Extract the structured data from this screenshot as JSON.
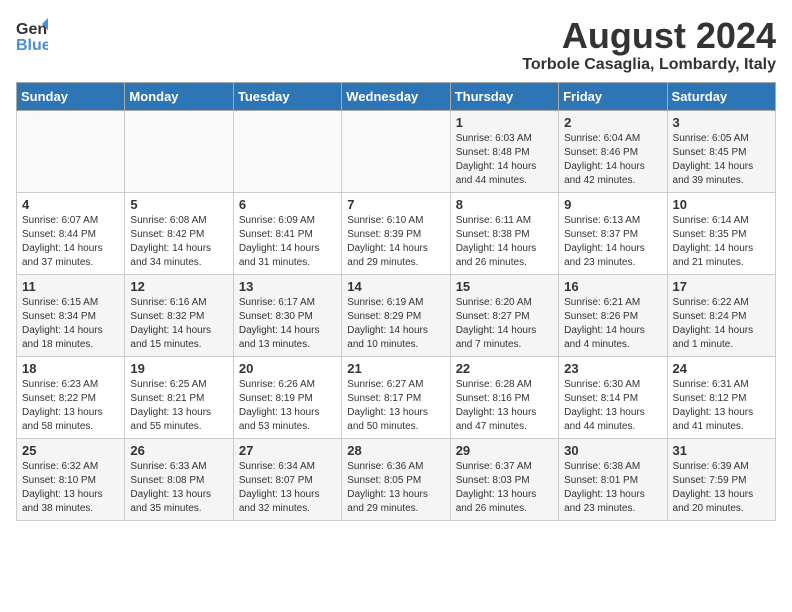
{
  "header": {
    "logo_general": "General",
    "logo_blue": "Blue",
    "main_title": "August 2024",
    "subtitle": "Torbole Casaglia, Lombardy, Italy"
  },
  "days_of_week": [
    "Sunday",
    "Monday",
    "Tuesday",
    "Wednesday",
    "Thursday",
    "Friday",
    "Saturday"
  ],
  "weeks": [
    [
      {
        "day": "",
        "info": ""
      },
      {
        "day": "",
        "info": ""
      },
      {
        "day": "",
        "info": ""
      },
      {
        "day": "",
        "info": ""
      },
      {
        "day": "1",
        "info": "Sunrise: 6:03 AM\nSunset: 8:48 PM\nDaylight: 14 hours\nand 44 minutes."
      },
      {
        "day": "2",
        "info": "Sunrise: 6:04 AM\nSunset: 8:46 PM\nDaylight: 14 hours\nand 42 minutes."
      },
      {
        "day": "3",
        "info": "Sunrise: 6:05 AM\nSunset: 8:45 PM\nDaylight: 14 hours\nand 39 minutes."
      }
    ],
    [
      {
        "day": "4",
        "info": "Sunrise: 6:07 AM\nSunset: 8:44 PM\nDaylight: 14 hours\nand 37 minutes."
      },
      {
        "day": "5",
        "info": "Sunrise: 6:08 AM\nSunset: 8:42 PM\nDaylight: 14 hours\nand 34 minutes."
      },
      {
        "day": "6",
        "info": "Sunrise: 6:09 AM\nSunset: 8:41 PM\nDaylight: 14 hours\nand 31 minutes."
      },
      {
        "day": "7",
        "info": "Sunrise: 6:10 AM\nSunset: 8:39 PM\nDaylight: 14 hours\nand 29 minutes."
      },
      {
        "day": "8",
        "info": "Sunrise: 6:11 AM\nSunset: 8:38 PM\nDaylight: 14 hours\nand 26 minutes."
      },
      {
        "day": "9",
        "info": "Sunrise: 6:13 AM\nSunset: 8:37 PM\nDaylight: 14 hours\nand 23 minutes."
      },
      {
        "day": "10",
        "info": "Sunrise: 6:14 AM\nSunset: 8:35 PM\nDaylight: 14 hours\nand 21 minutes."
      }
    ],
    [
      {
        "day": "11",
        "info": "Sunrise: 6:15 AM\nSunset: 8:34 PM\nDaylight: 14 hours\nand 18 minutes."
      },
      {
        "day": "12",
        "info": "Sunrise: 6:16 AM\nSunset: 8:32 PM\nDaylight: 14 hours\nand 15 minutes."
      },
      {
        "day": "13",
        "info": "Sunrise: 6:17 AM\nSunset: 8:30 PM\nDaylight: 14 hours\nand 13 minutes."
      },
      {
        "day": "14",
        "info": "Sunrise: 6:19 AM\nSunset: 8:29 PM\nDaylight: 14 hours\nand 10 minutes."
      },
      {
        "day": "15",
        "info": "Sunrise: 6:20 AM\nSunset: 8:27 PM\nDaylight: 14 hours\nand 7 minutes."
      },
      {
        "day": "16",
        "info": "Sunrise: 6:21 AM\nSunset: 8:26 PM\nDaylight: 14 hours\nand 4 minutes."
      },
      {
        "day": "17",
        "info": "Sunrise: 6:22 AM\nSunset: 8:24 PM\nDaylight: 14 hours\nand 1 minute."
      }
    ],
    [
      {
        "day": "18",
        "info": "Sunrise: 6:23 AM\nSunset: 8:22 PM\nDaylight: 13 hours\nand 58 minutes."
      },
      {
        "day": "19",
        "info": "Sunrise: 6:25 AM\nSunset: 8:21 PM\nDaylight: 13 hours\nand 55 minutes."
      },
      {
        "day": "20",
        "info": "Sunrise: 6:26 AM\nSunset: 8:19 PM\nDaylight: 13 hours\nand 53 minutes."
      },
      {
        "day": "21",
        "info": "Sunrise: 6:27 AM\nSunset: 8:17 PM\nDaylight: 13 hours\nand 50 minutes."
      },
      {
        "day": "22",
        "info": "Sunrise: 6:28 AM\nSunset: 8:16 PM\nDaylight: 13 hours\nand 47 minutes."
      },
      {
        "day": "23",
        "info": "Sunrise: 6:30 AM\nSunset: 8:14 PM\nDaylight: 13 hours\nand 44 minutes."
      },
      {
        "day": "24",
        "info": "Sunrise: 6:31 AM\nSunset: 8:12 PM\nDaylight: 13 hours\nand 41 minutes."
      }
    ],
    [
      {
        "day": "25",
        "info": "Sunrise: 6:32 AM\nSunset: 8:10 PM\nDaylight: 13 hours\nand 38 minutes."
      },
      {
        "day": "26",
        "info": "Sunrise: 6:33 AM\nSunset: 8:08 PM\nDaylight: 13 hours\nand 35 minutes."
      },
      {
        "day": "27",
        "info": "Sunrise: 6:34 AM\nSunset: 8:07 PM\nDaylight: 13 hours\nand 32 minutes."
      },
      {
        "day": "28",
        "info": "Sunrise: 6:36 AM\nSunset: 8:05 PM\nDaylight: 13 hours\nand 29 minutes."
      },
      {
        "day": "29",
        "info": "Sunrise: 6:37 AM\nSunset: 8:03 PM\nDaylight: 13 hours\nand 26 minutes."
      },
      {
        "day": "30",
        "info": "Sunrise: 6:38 AM\nSunset: 8:01 PM\nDaylight: 13 hours\nand 23 minutes."
      },
      {
        "day": "31",
        "info": "Sunrise: 6:39 AM\nSunset: 7:59 PM\nDaylight: 13 hours\nand 20 minutes."
      }
    ]
  ]
}
